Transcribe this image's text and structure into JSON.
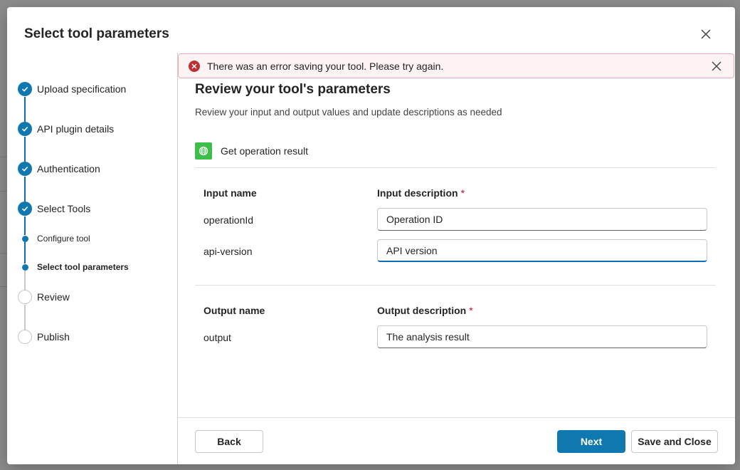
{
  "dialog": {
    "title": "Select tool parameters"
  },
  "stepper": {
    "steps": [
      {
        "label": "Upload specification",
        "state": "complete"
      },
      {
        "label": "API plugin details",
        "state": "complete"
      },
      {
        "label": "Authentication",
        "state": "complete"
      },
      {
        "label": "Select Tools",
        "state": "complete"
      },
      {
        "label": "Configure tool",
        "state": "substep"
      },
      {
        "label": "Select tool parameters",
        "state": "current-substep"
      },
      {
        "label": "Review",
        "state": "pending"
      },
      {
        "label": "Publish",
        "state": "pending"
      }
    ]
  },
  "error": {
    "message": "There was an error saving your tool. Please try again."
  },
  "main": {
    "heading": "Review your tool's parameters",
    "subheading": "Review your input and output values and update descriptions as needed",
    "operation": "Get operation result",
    "inputs": {
      "name_header": "Input name",
      "desc_header": "Input description",
      "required_mark": "*",
      "rows": [
        {
          "name": "operationId",
          "description": "Operation ID"
        },
        {
          "name": "api-version",
          "description": "API version"
        }
      ]
    },
    "outputs": {
      "name_header": "Output name",
      "desc_header": "Output description",
      "required_mark": "*",
      "rows": [
        {
          "name": "output",
          "description": "The analysis result"
        }
      ]
    }
  },
  "footer": {
    "back_label": "Back",
    "next_label": "Next",
    "save_close_label": "Save and Close"
  },
  "colors": {
    "accent": "#0f78b0",
    "error": "#bc2f32",
    "error_bg": "#fdf3f4",
    "operation_icon": "#3cbf4a"
  }
}
